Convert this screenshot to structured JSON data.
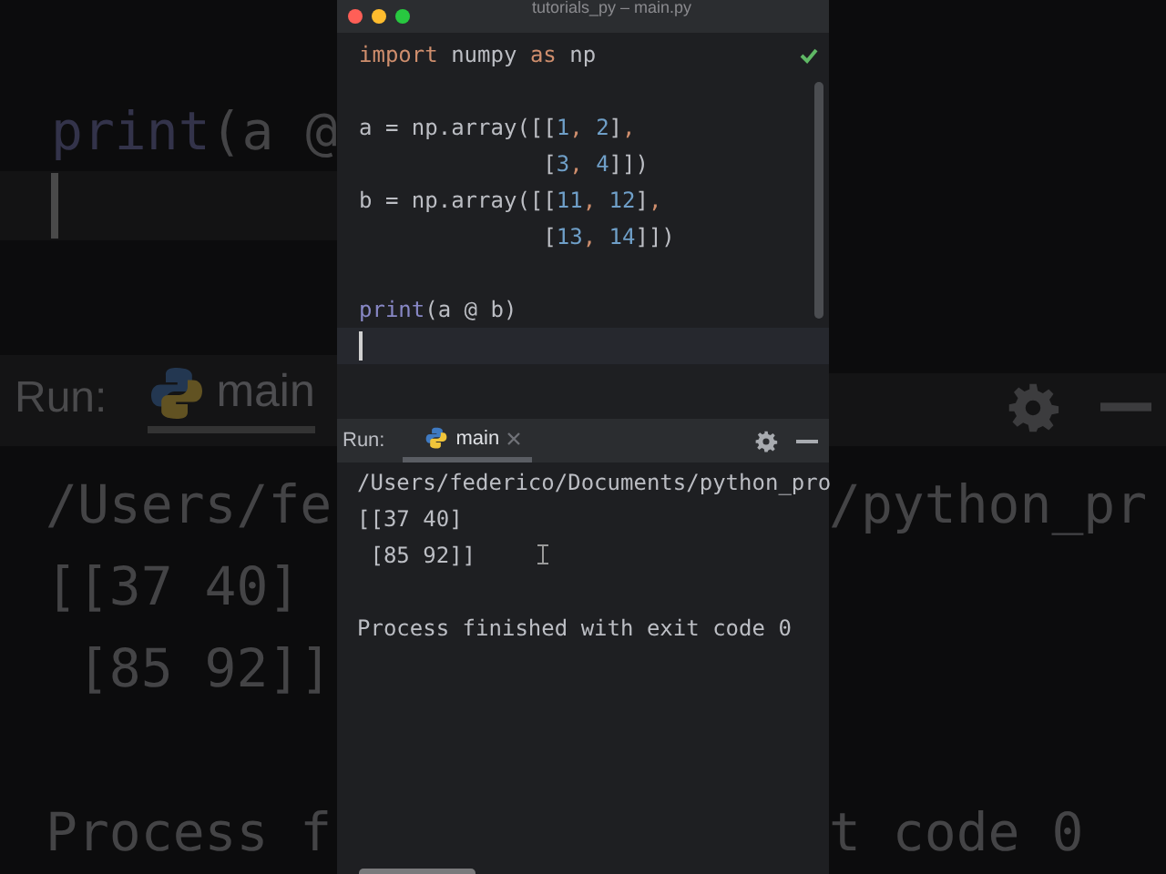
{
  "window": {
    "title": "tutorials_py – main.py"
  },
  "editor": {
    "lines": [
      {
        "current": false,
        "tokens": [
          {
            "kind": "keyword",
            "text": "import"
          },
          {
            "kind": "plain",
            "text": " numpy "
          },
          {
            "kind": "keyword",
            "text": "as"
          },
          {
            "kind": "plain",
            "text": " np"
          }
        ]
      },
      {
        "current": false
      },
      {
        "current": false,
        "tokens": [
          {
            "kind": "plain",
            "text": "a = np.array([["
          },
          {
            "kind": "number",
            "text": "1"
          },
          {
            "kind": "punct",
            "text": ", "
          },
          {
            "kind": "number",
            "text": "2"
          },
          {
            "kind": "plain",
            "text": "]"
          },
          {
            "kind": "punct",
            "text": ","
          }
        ]
      },
      {
        "current": false,
        "tokens": [
          {
            "kind": "plain",
            "text": "              ["
          },
          {
            "kind": "number",
            "text": "3"
          },
          {
            "kind": "punct",
            "text": ", "
          },
          {
            "kind": "number",
            "text": "4"
          },
          {
            "kind": "plain",
            "text": "]])"
          }
        ]
      },
      {
        "current": false,
        "tokens": [
          {
            "kind": "plain",
            "text": "b = np.array([["
          },
          {
            "kind": "number",
            "text": "11"
          },
          {
            "kind": "punct",
            "text": ", "
          },
          {
            "kind": "number",
            "text": "12"
          },
          {
            "kind": "plain",
            "text": "]"
          },
          {
            "kind": "punct",
            "text": ","
          }
        ]
      },
      {
        "current": false,
        "tokens": [
          {
            "kind": "plain",
            "text": "              ["
          },
          {
            "kind": "number",
            "text": "13"
          },
          {
            "kind": "punct",
            "text": ", "
          },
          {
            "kind": "number",
            "text": "14"
          },
          {
            "kind": "plain",
            "text": "]])"
          }
        ]
      },
      {
        "current": false
      },
      {
        "current": false,
        "tokens": [
          {
            "kind": "builtin",
            "text": "print"
          },
          {
            "kind": "plain",
            "text": "(a @ b)"
          }
        ]
      },
      {
        "current": true
      }
    ]
  },
  "run_panel": {
    "label": "Run:",
    "tab": {
      "label": "main",
      "selected": true
    },
    "output": [
      "/Users/federico/Documents/python_pro",
      "[[37 40]",
      " [85 92]]"
    ],
    "exit_message": "Process finished with exit code 0"
  },
  "backdrop": {
    "left": {
      "code": [
        {
          "kind": "builtin",
          "text": "print"
        },
        {
          "kind": "plain",
          "text": "(a @"
        }
      ],
      "run_label": "Run:",
      "tab": "main",
      "output": [
        "/Users/fe",
        "[[37 40]",
        " [85 92]]"
      ],
      "exit_message": "Process f"
    },
    "right": {
      "output": [
        "/python_pr"
      ],
      "exit_message": "t code 0"
    }
  }
}
